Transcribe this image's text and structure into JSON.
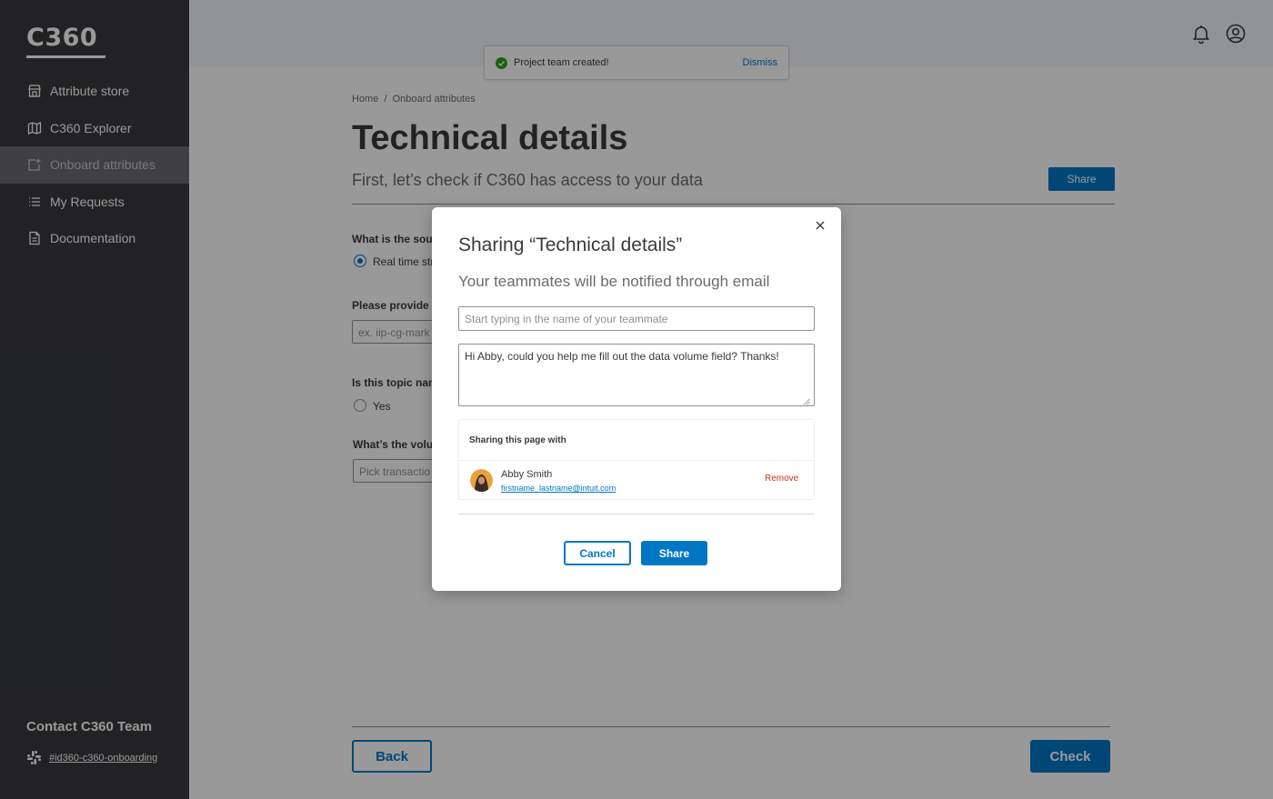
{
  "sidebar": {
    "logo": "C360",
    "items": [
      {
        "label": "Attribute store",
        "icon": "store-icon"
      },
      {
        "label": "C360 Explorer",
        "icon": "map-icon"
      },
      {
        "label": "Onboard attributes",
        "icon": "onboard-icon",
        "active": true
      },
      {
        "label": "My Requests",
        "icon": "list-icon"
      },
      {
        "label": "Documentation",
        "icon": "document-icon"
      }
    ],
    "contact_title": "Contact C360 Team",
    "slack_channel": "#id360-c360-onboarding"
  },
  "toast": {
    "message": "Project team created!",
    "dismiss": "Dismiss"
  },
  "breadcrumb": "Home  /  Onboard attributes",
  "page": {
    "title": "Technical details",
    "subtitle": "First, let’s check if C360 has access to your data",
    "share_label": "Share"
  },
  "form": {
    "q1": "What is the sour",
    "q1_option": "Real time str",
    "q2": "Please provide n",
    "q2_placeholder": "ex. iip-cg-mark",
    "q3": "Is this topic nam",
    "q3_option": "Yes",
    "q4": "What’s the volun",
    "q4_placeholder": "Pick transactio"
  },
  "footer": {
    "back": "Back",
    "check": "Check"
  },
  "modal": {
    "title": "Sharing “Technical details”",
    "subtitle": "Your teammates will be notified through email",
    "teammate_placeholder": "Start typing in the name of your teammate",
    "message": "Hi Abby, could you help me fill out the data volume field? Thanks!",
    "sharing_heading": "Sharing this page with",
    "person_name": "Abby Smith",
    "person_email": "firstname_lastname@intuit.com",
    "remove": "Remove",
    "cancel": "Cancel",
    "share": "Share"
  },
  "colors": {
    "accent": "#0077c5",
    "sidebar": "#393a3d",
    "danger": "#d52b1e",
    "success": "#2ca01c"
  }
}
